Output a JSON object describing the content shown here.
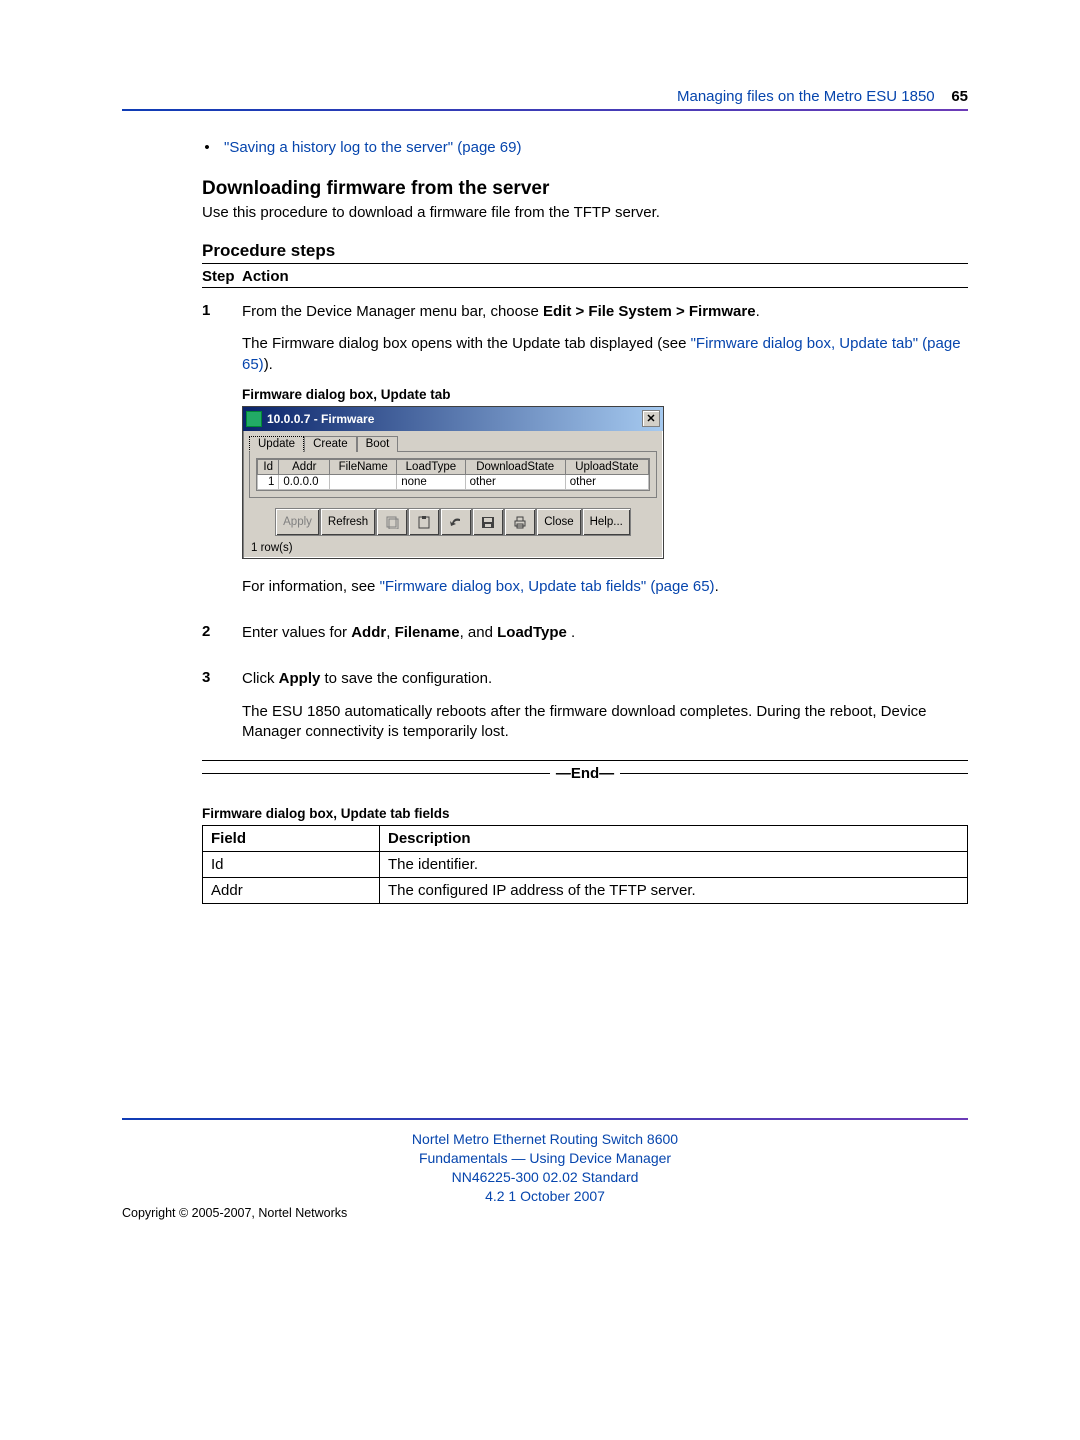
{
  "header": {
    "title": "Managing files on the Metro ESU 1850",
    "page_number": "65"
  },
  "bullet": {
    "text": "\"Saving a history log to the server\" (page 69)"
  },
  "section": {
    "heading": "Downloading firmware from the server",
    "intro": "Use this procedure to download a firmware file from the TFTP server."
  },
  "procedure": {
    "heading": "Procedure steps",
    "col_step": "Step",
    "col_action": "Action",
    "steps": [
      {
        "num": "1",
        "p1a": "From the Device Manager menu bar, choose ",
        "p1b": "Edit > File System > Firmware",
        "p1c": ".",
        "p2a": "The Firmware dialog box opens with the Update tab displayed (see ",
        "p2link": "\"Firmware dialog box, Update tab\" (page 65)",
        "p2b": ").",
        "caption": "Firmware dialog box, Update tab",
        "post_a": "For information, see ",
        "post_link": "\"Firmware dialog box, Update tab fields\" (page 65)",
        "post_b": "."
      },
      {
        "num": "2",
        "p_a": "Enter values for ",
        "p_b1": "Addr",
        "p_sep1": ", ",
        "p_b2": "Filename",
        "p_sep2": ", and ",
        "p_b3": "LoadType",
        "p_c": " ."
      },
      {
        "num": "3",
        "p_a": "Click ",
        "p_b": "Apply",
        "p_c": " to save the configuration.",
        "p2": "The ESU 1850 automatically reboots after the firmware download completes. During the reboot, Device Manager connectivity is temporarily lost."
      }
    ],
    "end": "—End—"
  },
  "dialog": {
    "title": "10.0.0.7 - Firmware",
    "tabs": [
      "Update",
      "Create",
      "Boot"
    ],
    "columns": [
      "Id",
      "Addr",
      "FileName",
      "LoadType",
      "DownloadState",
      "UploadState"
    ],
    "row": {
      "Id": "1",
      "Addr": "0.0.0.0",
      "FileName": "",
      "LoadType": "none",
      "DownloadState": "other",
      "UploadState": "other"
    },
    "buttons": {
      "apply": "Apply",
      "refresh": "Refresh",
      "close": "Close",
      "help": "Help..."
    },
    "status": "1 row(s)"
  },
  "fields_table": {
    "caption": "Firmware dialog box, Update tab fields",
    "headers": [
      "Field",
      "Description"
    ],
    "rows": [
      {
        "field": "Id",
        "desc": "The identifier."
      },
      {
        "field": "Addr",
        "desc": "The configured IP address of the TFTP server."
      }
    ]
  },
  "footer": {
    "l1": "Nortel Metro Ethernet Routing Switch 8600",
    "l2": "Fundamentals — Using Device Manager",
    "l3": "NN46225-300   02.02   Standard",
    "l4": "4.2   1 October 2007",
    "copyright": "Copyright © 2005-2007, Nortel Networks"
  }
}
